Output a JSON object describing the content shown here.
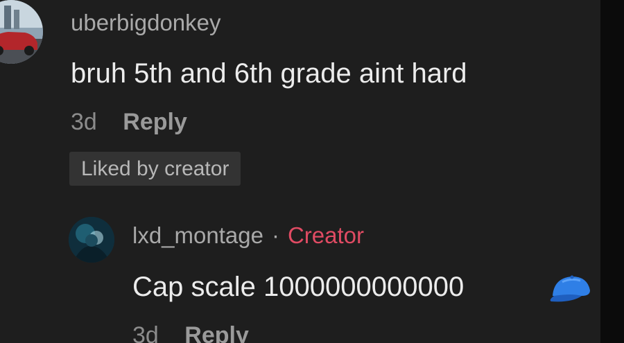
{
  "comment": {
    "username": "uberbigdonkey",
    "text": "bruh 5th and 6th grade aint hard",
    "time": "3d",
    "reply_label": "Reply",
    "liked_badge": "Liked by creator",
    "avatar_icon": "car-photo-avatar"
  },
  "reply": {
    "username": "lxd_montage",
    "separator": "·",
    "badge": "Creator",
    "text": "Cap scale 1000000000000",
    "emoji_icon": "blue-cap-icon",
    "time": "3d",
    "reply_label": "Reply",
    "avatar_icon": "dark-teal-profile-avatar"
  },
  "colors": {
    "background": "#1e1e1e",
    "creator_badge": "#e04b63",
    "cap_blue": "#2f7fe6"
  }
}
